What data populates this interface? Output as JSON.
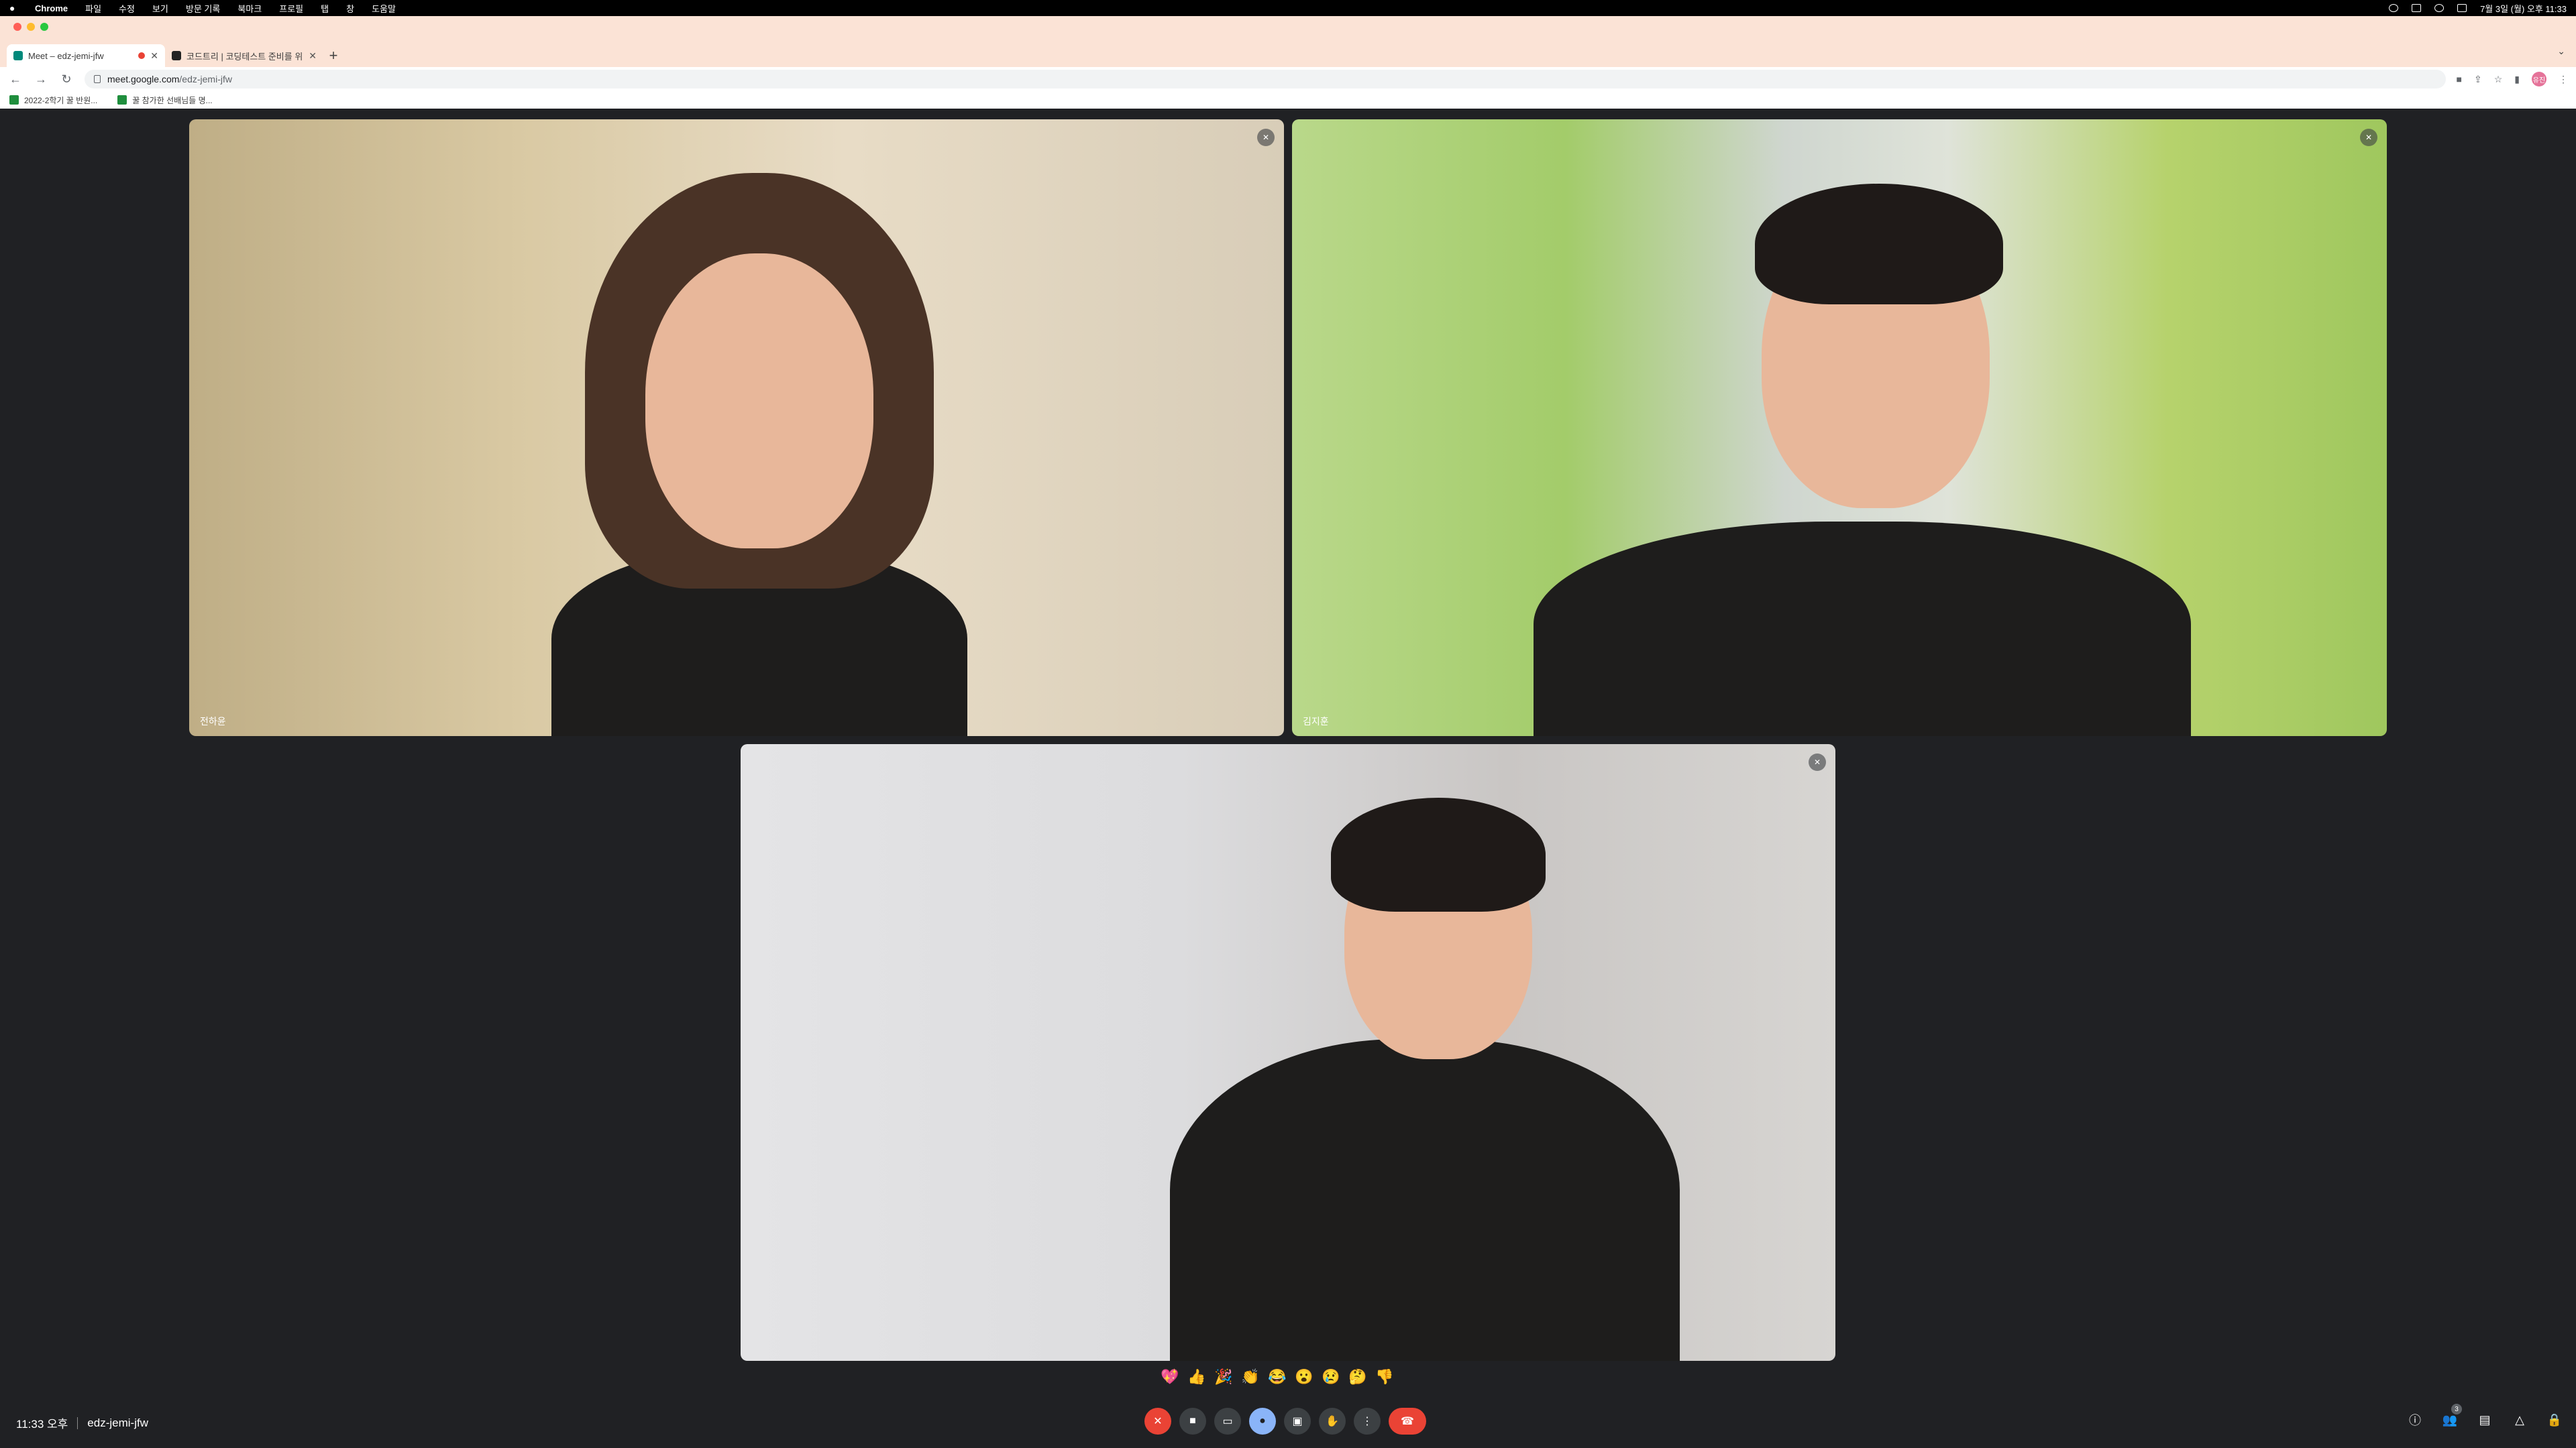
{
  "menubar": {
    "items": [
      "Chrome",
      "파일",
      "수정",
      "보기",
      "방문 기록",
      "북마크",
      "프로필",
      "탭",
      "창",
      "도움말"
    ],
    "clock": "7월 3일 (월) 오후 11:33"
  },
  "tabs": [
    {
      "title": "Meet – edz-jemi-jfw",
      "active": true,
      "favicon_color": "#00897b",
      "recording": true
    },
    {
      "title": "코드트리 | 코딩테스트 준비를 위한 :",
      "active": false,
      "favicon_color": "#222222",
      "recording": false
    }
  ],
  "toolbar": {
    "url_host": "meet.google.com",
    "url_path": "/edz-jemi-jfw",
    "profile_initials": "유진"
  },
  "bookmarks": [
    {
      "label": "2022-2학기 꿀 반원..."
    },
    {
      "label": "꿀 참가한 선배님들 명..."
    }
  ],
  "participants": [
    {
      "name": "전하윤"
    },
    {
      "name": "김지훈"
    },
    {
      "name": ""
    }
  ],
  "reactions": [
    "💖",
    "👍",
    "🎉",
    "👏",
    "😂",
    "😮",
    "😢",
    "🤔",
    "👎"
  ],
  "meeting": {
    "time": "11:33 오후",
    "code": "edz-jemi-jfw",
    "participant_count": "3"
  },
  "colors": {
    "background": "#202124",
    "end_call": "#ea4335",
    "mic_off": "#ea4335",
    "effects_active": "#8ab4f8"
  },
  "icons": {
    "controls": [
      "mic-off-icon",
      "camera-icon",
      "captions-icon",
      "effects-icon",
      "present-icon",
      "raise-hand-icon",
      "more-options-icon",
      "end-call-icon"
    ],
    "side": [
      "info-icon",
      "people-icon",
      "chat-icon",
      "activities-icon",
      "host-controls-icon"
    ]
  }
}
